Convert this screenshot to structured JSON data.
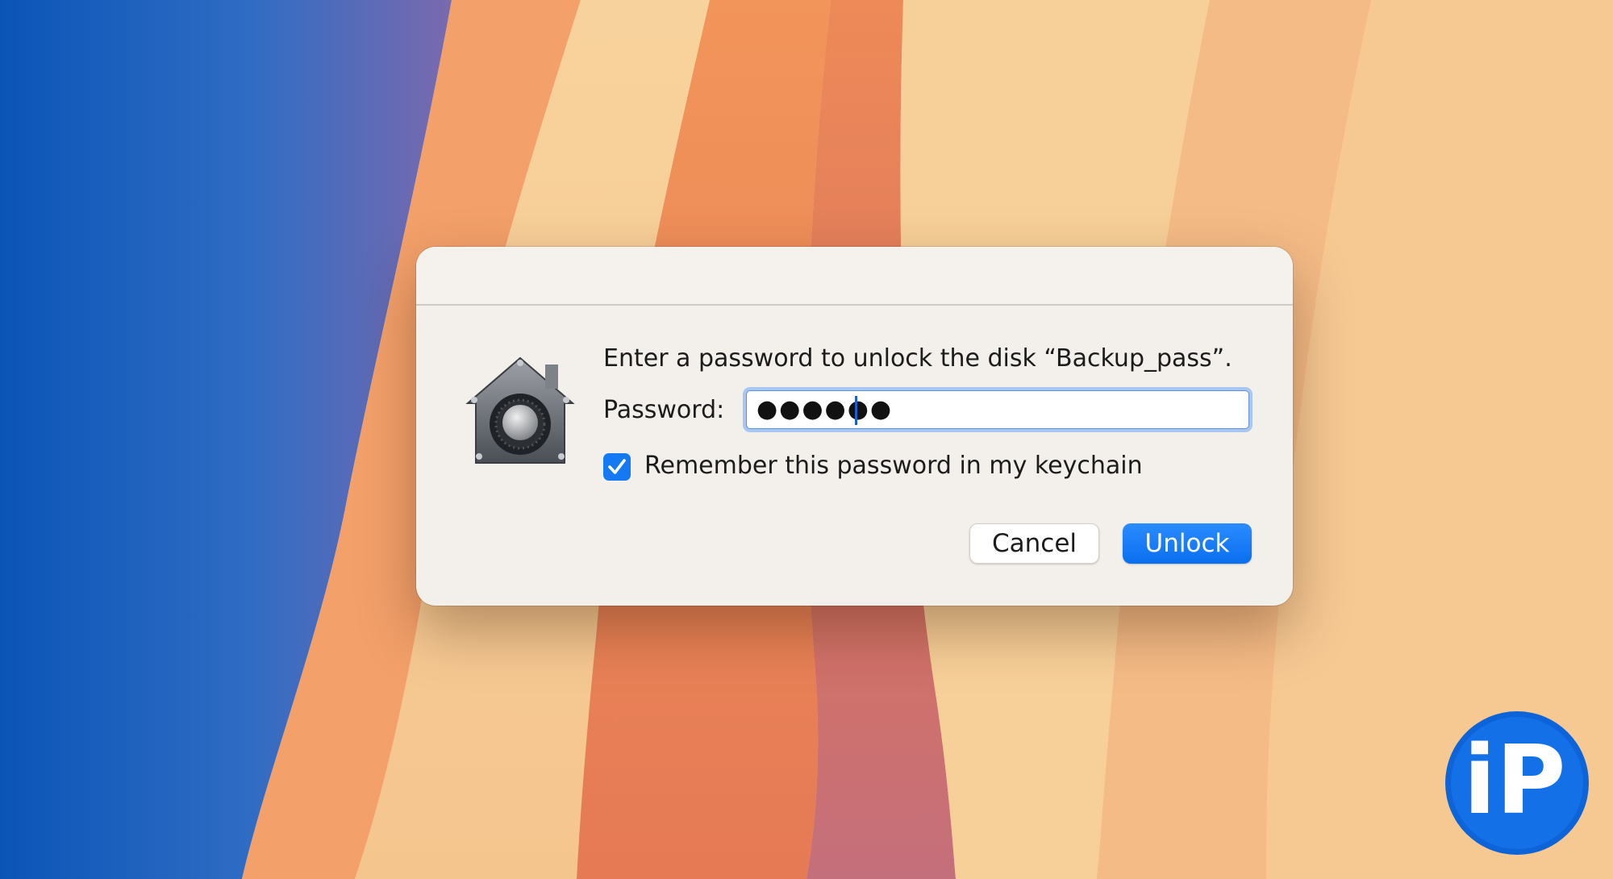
{
  "dialog": {
    "message": "Enter a password to unlock the disk “Backup_pass”.",
    "password_label": "Password:",
    "password_mask": "●●●●●●",
    "remember_checked": true,
    "remember_label": "Remember this password in my keychain",
    "cancel_label": "Cancel",
    "unlock_label": "Unlock",
    "icon": "gatekeeper-lock-house-icon"
  },
  "watermark": {
    "text": "iP",
    "icon": "iphones-logo-icon"
  },
  "colors": {
    "accent": "#1479f2",
    "dialog_bg": "#f3efea",
    "logo_blue": "#0d63d8"
  }
}
